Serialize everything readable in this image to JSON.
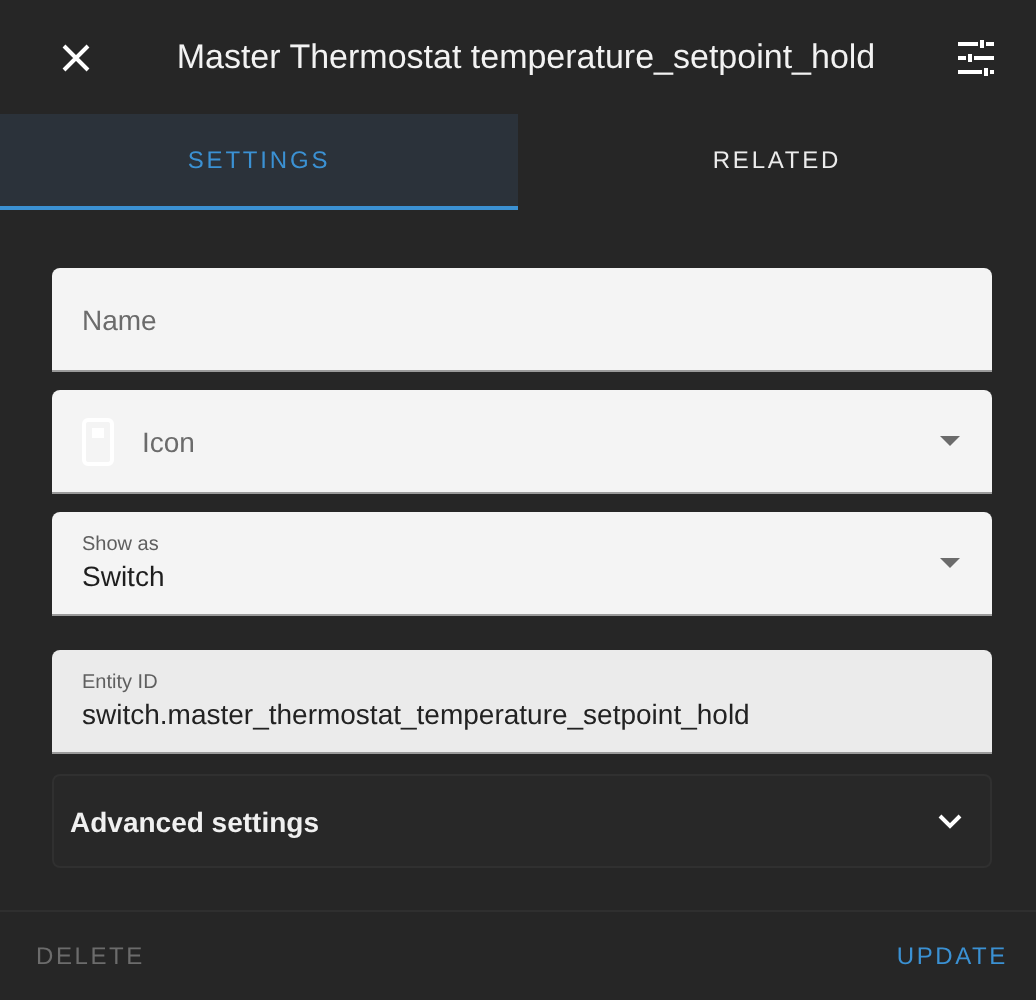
{
  "dialog": {
    "title": "Master Thermostat temperature_setpoint_hold"
  },
  "tabs": [
    {
      "label": "SETTINGS",
      "selected": true
    },
    {
      "label": "RELATED",
      "selected": false
    }
  ],
  "fields": [
    {
      "kind": "text",
      "placeholder": "Name"
    },
    {
      "kind": "icon-select",
      "placeholder": "Icon"
    },
    {
      "kind": "select",
      "label": "Show as",
      "value": "Switch"
    },
    {
      "kind": "text",
      "label": "Entity ID",
      "value": "switch.master_thermostat_temperature_setpoint_hold",
      "disabled": true
    }
  ],
  "advanced": {
    "label": "Advanced settings",
    "expanded": false
  },
  "footer": {
    "delete": {
      "label": "DELETE",
      "disabled": true
    },
    "update": {
      "label": "UPDATE",
      "disabled": false
    }
  }
}
